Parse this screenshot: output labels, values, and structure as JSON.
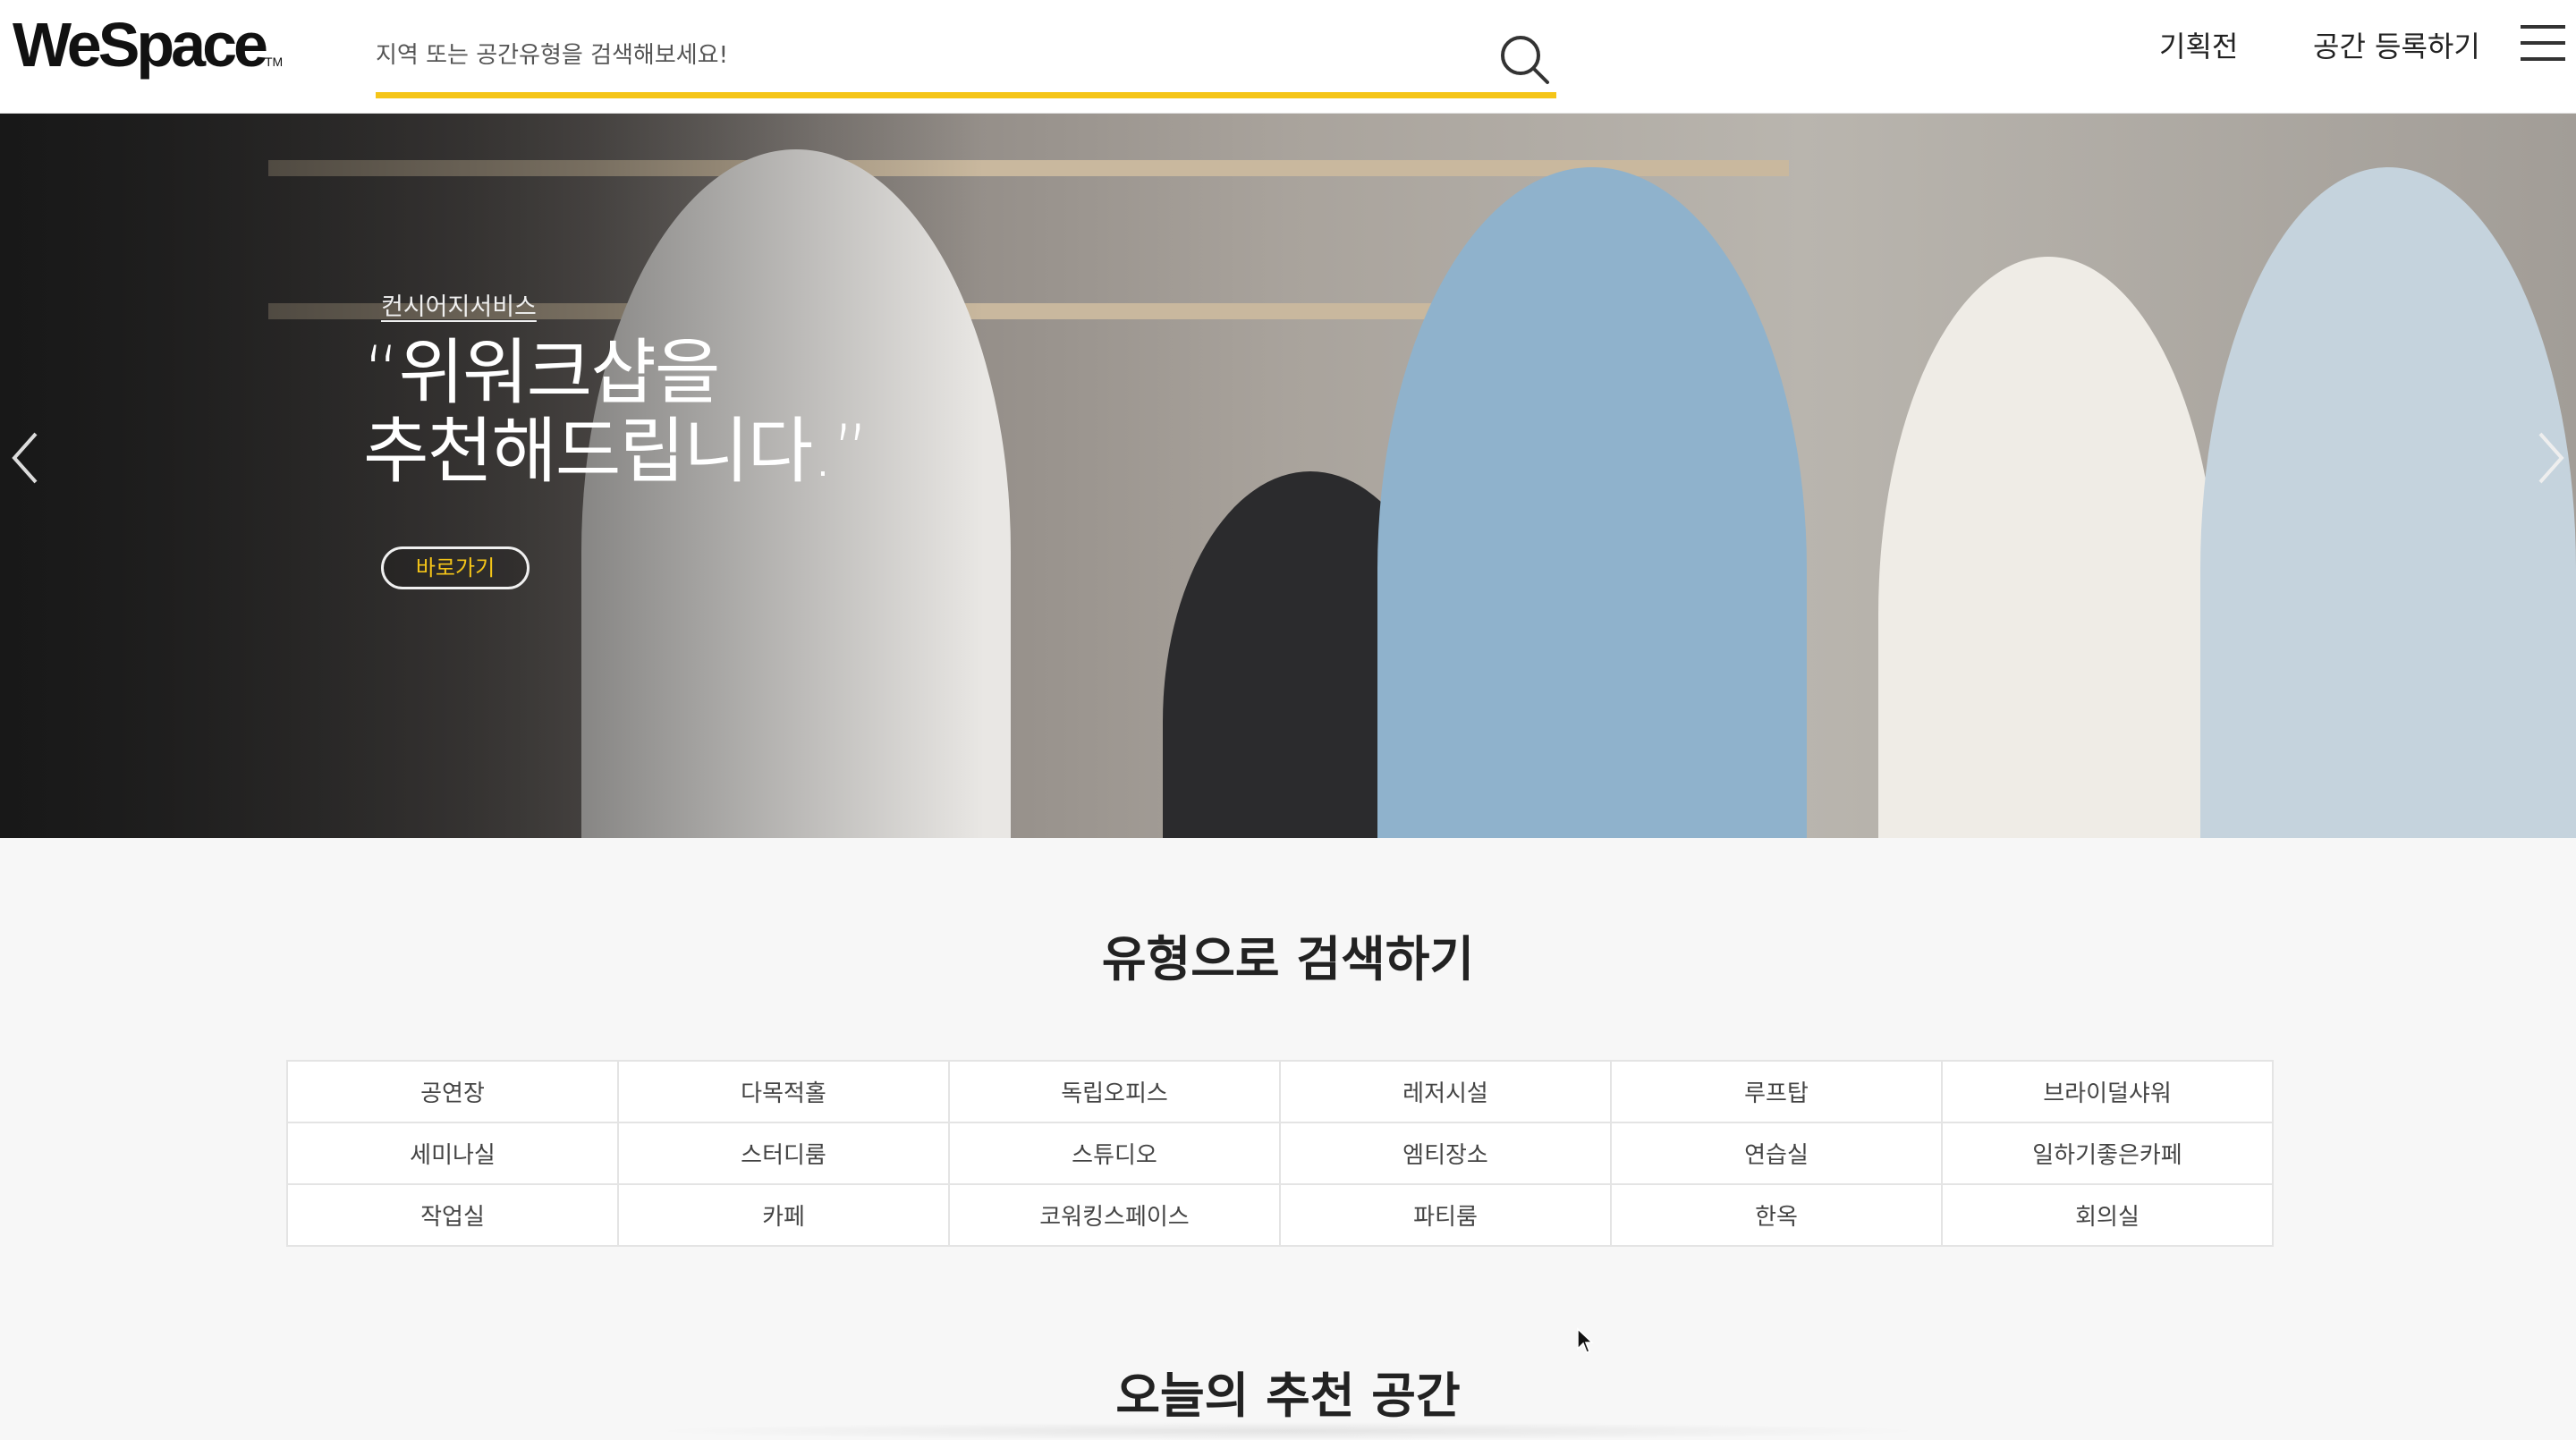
{
  "header": {
    "logo": "WeSpace",
    "logo_tm": "TM",
    "search_placeholder": "지역 또는 공간유형을 검색해보세요!",
    "nav": {
      "exhibition": "기획전",
      "register": "공간 등록하기"
    },
    "search_icon": "search-icon",
    "menu_icon": "hamburger-menu-icon"
  },
  "hero": {
    "subtitle": "컨시어지서비스",
    "title": "“위워크샵을\n 추천해드립니다.”",
    "button": "바로가기",
    "prev_icon": "chevron-left-icon",
    "next_icon": "chevron-right-icon"
  },
  "type_section": {
    "title": "유형으로 검색하기",
    "categories": [
      "공연장",
      "다목적홀",
      "독립오피스",
      "레저시설",
      "루프탑",
      "브라이덜샤워",
      "세미나실",
      "스터디룸",
      "스튜디오",
      "엠티장소",
      "연습실",
      "일하기좋은카페",
      "작업실",
      "카페",
      "코워킹스페이스",
      "파티룸",
      "한옥",
      "회의실"
    ]
  },
  "today_section": {
    "title": "오늘의 추천 공간"
  },
  "colors": {
    "accent": "#f5c518",
    "background": "#f7f7f7",
    "header_bg": "#ffffff"
  }
}
